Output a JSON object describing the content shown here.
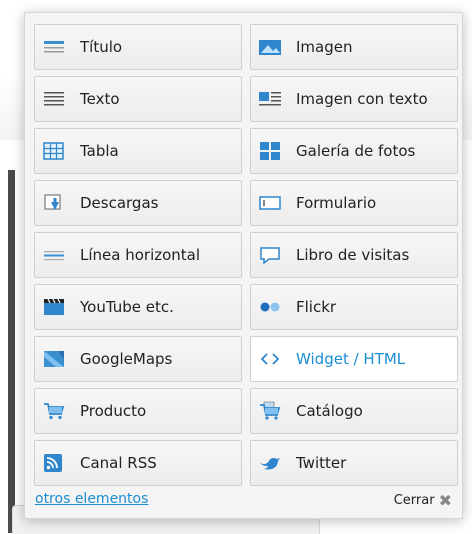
{
  "items": [
    {
      "label": "Título",
      "icon": "title-icon"
    },
    {
      "label": "Imagen",
      "icon": "image-icon"
    },
    {
      "label": "Texto",
      "icon": "text-icon"
    },
    {
      "label": "Imagen con texto",
      "icon": "image-text-icon"
    },
    {
      "label": "Tabla",
      "icon": "table-icon"
    },
    {
      "label": "Galería de fotos",
      "icon": "photo-gallery-icon"
    },
    {
      "label": "Descargas",
      "icon": "downloads-icon"
    },
    {
      "label": "Formulario",
      "icon": "form-icon"
    },
    {
      "label": "Línea horizontal",
      "icon": "horizontal-line-icon"
    },
    {
      "label": "Libro de visitas",
      "icon": "guestbook-icon"
    },
    {
      "label": "YouTube etc.",
      "icon": "video-icon"
    },
    {
      "label": "Flickr",
      "icon": "flickr-icon"
    },
    {
      "label": "GoogleMaps",
      "icon": "map-icon"
    },
    {
      "label": "Widget / HTML",
      "icon": "code-icon"
    },
    {
      "label": "Producto",
      "icon": "cart-icon"
    },
    {
      "label": "Catálogo",
      "icon": "catalog-cart-icon"
    },
    {
      "label": "Canal RSS",
      "icon": "rss-icon"
    },
    {
      "label": "Twitter",
      "icon": "twitter-icon"
    }
  ],
  "footer": {
    "more_link": "otros elementos",
    "close_label": "Cerrar"
  },
  "colors": {
    "accent": "#1b8ed4",
    "icon_blue": "#3a8fd0",
    "panel_bg": "#f4f4f4"
  }
}
